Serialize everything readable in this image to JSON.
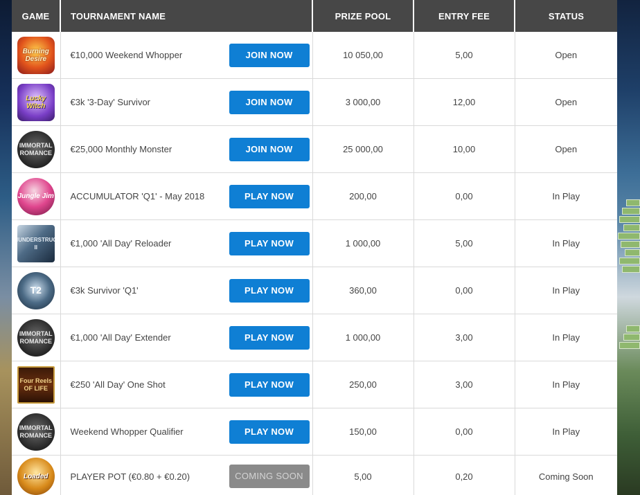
{
  "table": {
    "headers": {
      "game": "GAME",
      "name": "TOURNAMENT NAME",
      "prize_pool": "PRIZE POOL",
      "entry_fee": "ENTRY FEE",
      "status": "STATUS"
    },
    "rows": [
      {
        "game_icon": "burning-desire-icon",
        "game_label": "Burning Desire",
        "name": "€10,000 Weekend Whopper",
        "button": "JOIN NOW",
        "prize_pool": "10 050,00",
        "entry_fee": "5,00",
        "status": "Open"
      },
      {
        "game_icon": "lucky-witch-icon",
        "game_label": "Lucky Witch",
        "name": "€3k '3-Day' Survivor",
        "button": "JOIN NOW",
        "prize_pool": "3 000,00",
        "entry_fee": "12,00",
        "status": "Open"
      },
      {
        "game_icon": "immortal-romance-icon",
        "game_label": "IMMORTAL ROMANCE",
        "name": "€25,000 Monthly Monster",
        "button": "JOIN NOW",
        "prize_pool": "25 000,00",
        "entry_fee": "10,00",
        "status": "Open"
      },
      {
        "game_icon": "jungle-jim-icon",
        "game_label": "Jungle Jim",
        "name": "ACCUMULATOR 'Q1' - May 2018",
        "button": "PLAY NOW",
        "prize_pool": "200,00",
        "entry_fee": "0,00",
        "status": "In Play"
      },
      {
        "game_icon": "thunderstruck-icon",
        "game_label": "THUNDERSTRUCK II",
        "name": "€1,000 'All Day' Reloader",
        "button": "PLAY NOW",
        "prize_pool": "1 000,00",
        "entry_fee": "5,00",
        "status": "In Play"
      },
      {
        "game_icon": "t2-icon",
        "game_label": "T2",
        "name": "€3k Survivor 'Q1'",
        "button": "PLAY NOW",
        "prize_pool": "360,00",
        "entry_fee": "0,00",
        "status": "In Play"
      },
      {
        "game_icon": "immortal-romance-icon",
        "game_label": "IMMORTAL ROMANCE",
        "name": "€1,000 'All Day' Extender",
        "button": "PLAY NOW",
        "prize_pool": "1 000,00",
        "entry_fee": "3,00",
        "status": "In Play"
      },
      {
        "game_icon": "four-reels-of-life-icon",
        "game_label": "Four Reels OF LIFE",
        "name": "€250 'All Day' One Shot",
        "button": "PLAY NOW",
        "prize_pool": "250,00",
        "entry_fee": "3,00",
        "status": "In Play"
      },
      {
        "game_icon": "immortal-romance-icon",
        "game_label": "IMMORTAL ROMANCE",
        "name": "Weekend Whopper Qualifier",
        "button": "PLAY NOW",
        "prize_pool": "150,00",
        "entry_fee": "0,00",
        "status": "In Play"
      },
      {
        "game_icon": "loaded-icon",
        "game_label": "Loaded",
        "name": "PLAYER POT (€0.80 + €0.20)",
        "button": "COMING SOON",
        "prize_pool": "5,00",
        "entry_fee": "0,20",
        "status": "Coming Soon"
      }
    ]
  },
  "colors": {
    "header_bg": "#474747",
    "button_blue": "#0f7fd4",
    "button_disabled": "#8a8a8a"
  }
}
